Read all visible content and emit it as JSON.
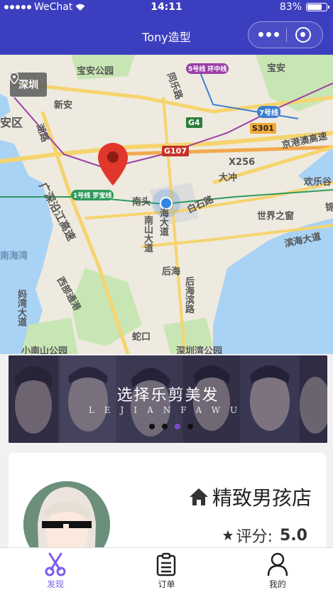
{
  "status_bar": {
    "carrier": "WeChat",
    "time": "14:11",
    "battery": "83%",
    "battery_level": 0.83
  },
  "nav": {
    "title": "Tony造型"
  },
  "map": {
    "city": "深圳",
    "labels": [
      "宝安公园",
      "新安",
      "安区",
      "湖路",
      "广深沿江高速",
      "1号线 罗宝线",
      "南头",
      "南山大道",
      "海大道",
      "白石路",
      "大冲",
      "世界之窗",
      "欢乐谷",
      "滨海大道",
      "后海",
      "后海滨路",
      "南海湾",
      "妈湾大道",
      "西部通港",
      "小南山公园",
      "蛇口",
      "深圳湾公园",
      "X256",
      "京港澳高速",
      "宝安",
      "同乐路",
      "锦"
    ],
    "road_badges": [
      "G4",
      "G107",
      "S301",
      "5号线 环中线",
      "7号线"
    ],
    "colors": {
      "water": "#a9d3f5",
      "park": "#c8e6b4",
      "road": "#f6d46e",
      "metro_green": "#2f9a5a",
      "metro_purple": "#9b3fa6"
    }
  },
  "banner": {
    "title": "选择乐剪美发",
    "subtitle": "LEJIANFAWU",
    "page_count": 4,
    "active_page": 3
  },
  "shop": {
    "name": "精致男孩店",
    "rating_label": "评分:",
    "rating_value": "5.0"
  },
  "tabs": [
    {
      "label": "发现",
      "icon": "scissors-icon",
      "active": true
    },
    {
      "label": "订单",
      "icon": "clipboard-icon",
      "active": false
    },
    {
      "label": "我的",
      "icon": "user-icon",
      "active": false
    }
  ],
  "accent_color": "#7c5cf0",
  "header_color": "#3c3ec0"
}
